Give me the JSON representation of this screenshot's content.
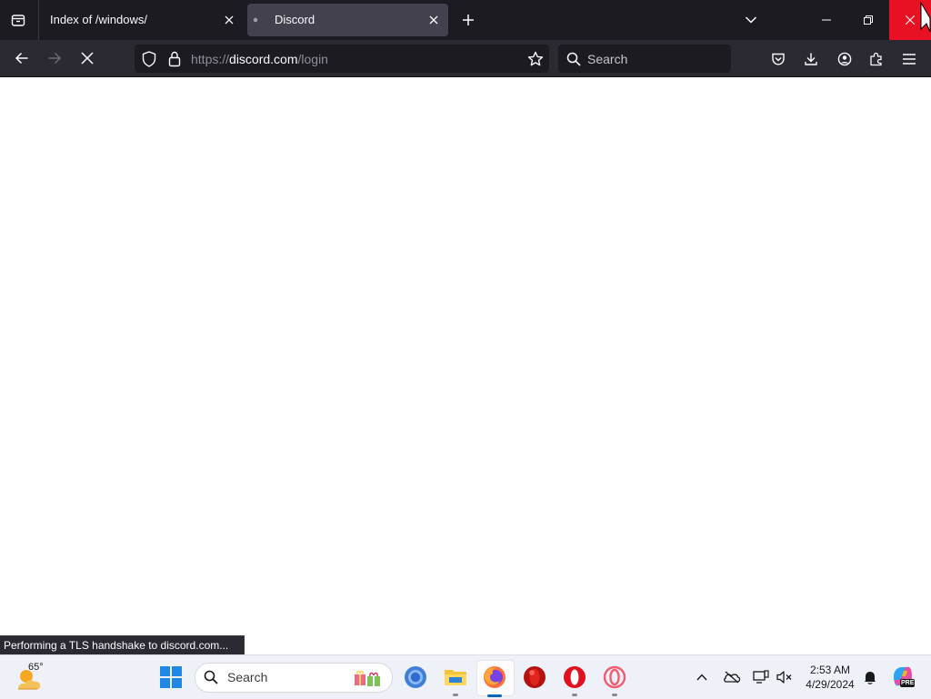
{
  "browser": {
    "tabs": [
      {
        "title": "Index of /windows/",
        "active": false
      },
      {
        "title": "Discord",
        "active": true
      }
    ],
    "url": {
      "scheme": "https://",
      "host": "discord.com",
      "path": "/login"
    },
    "search_placeholder": "Search",
    "status_text": "Performing a TLS handshake to discord.com..."
  },
  "taskbar": {
    "weather_temp": "65°",
    "search_placeholder": "Search",
    "time": "2:53 AM",
    "date": "4/29/2024",
    "copilot_badge": "PRE"
  },
  "colors": {
    "tabbar_bg": "#1c1b22",
    "toolbar_bg": "#2b2a33",
    "close_hover": "#e81123",
    "firefox_accent": "#ff7139"
  }
}
